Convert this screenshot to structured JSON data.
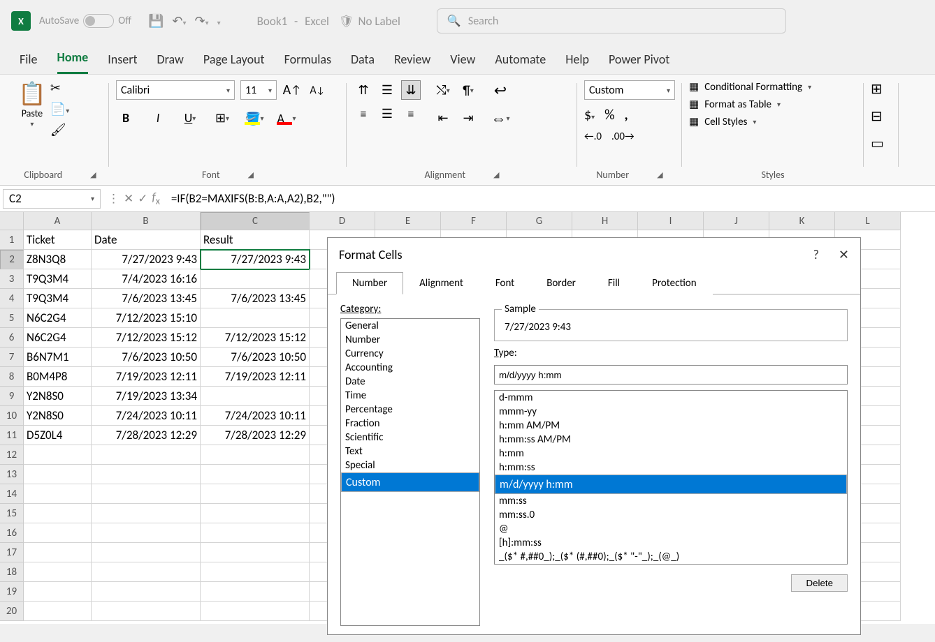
{
  "titlebar": {
    "autosave_label": "AutoSave",
    "autosave_state": "Off",
    "doc_name": "Book1",
    "app_name": "Excel",
    "sensitivity": "No Label",
    "search_placeholder": "Search"
  },
  "menu": [
    "File",
    "Home",
    "Insert",
    "Draw",
    "Page Layout",
    "Formulas",
    "Data",
    "Review",
    "View",
    "Automate",
    "Help",
    "Power Pivot"
  ],
  "menu_active": "Home",
  "ribbon": {
    "clipboard_label": "Clipboard",
    "paste": "Paste",
    "font_label": "Font",
    "font_name": "Calibri",
    "font_size": "11",
    "align_label": "Alignment",
    "number_label": "Number",
    "number_format": "Custom",
    "styles_label": "Styles",
    "cond_fmt": "Conditional Formatting",
    "as_table": "Format as Table",
    "cell_styles": "Cell Styles"
  },
  "name_box": "C2",
  "formula": "=IF(B2=MAXIFS(B:B,A:A,A2),B2,\"\")",
  "columns": [
    "A",
    "B",
    "C",
    "D",
    "E",
    "F",
    "G",
    "H",
    "I",
    "J",
    "K",
    "L"
  ],
  "rows": [
    "1",
    "2",
    "3",
    "4",
    "5",
    "6",
    "7",
    "8",
    "9",
    "10",
    "11",
    "12",
    "13",
    "14",
    "15",
    "16",
    "17",
    "18",
    "19",
    "20"
  ],
  "active_row": "2",
  "active_col": "C",
  "sheet": {
    "header": [
      "Ticket",
      "Date",
      "Result"
    ],
    "data": [
      [
        "Z8N3Q8",
        "7/27/2023 9:43",
        "7/27/2023 9:43"
      ],
      [
        "T9Q3M4",
        "7/4/2023 16:16",
        ""
      ],
      [
        "T9Q3M4",
        "7/6/2023 13:45",
        "7/6/2023 13:45"
      ],
      [
        "N6C2G4",
        "7/12/2023 15:10",
        ""
      ],
      [
        "N6C2G4",
        "7/12/2023 15:12",
        "7/12/2023 15:12"
      ],
      [
        "B6N7M1",
        "7/6/2023 10:50",
        "7/6/2023 10:50"
      ],
      [
        "B0M4P8",
        "7/19/2023 12:11",
        "7/19/2023 12:11"
      ],
      [
        "Y2N8S0",
        "7/19/2023 13:34",
        ""
      ],
      [
        "Y2N8S0",
        "7/24/2023 10:11",
        "7/24/2023 10:11"
      ],
      [
        "D5Z0L4",
        "7/28/2023 12:29",
        "7/28/2023 12:29"
      ]
    ]
  },
  "dialog": {
    "title": "Format Cells",
    "tabs": [
      "Number",
      "Alignment",
      "Font",
      "Border",
      "Fill",
      "Protection"
    ],
    "tab_active": "Number",
    "category_label": "Category:",
    "categories": [
      "General",
      "Number",
      "Currency",
      "Accounting",
      "Date",
      "Time",
      "Percentage",
      "Fraction",
      "Scientific",
      "Text",
      "Special",
      "Custom"
    ],
    "category_selected": "Custom",
    "sample_label": "Sample",
    "sample_value": "7/27/2023 9:43",
    "type_label": "Type:",
    "type_value": "m/d/yyyy h:mm",
    "type_list": [
      "d-mmm",
      "mmm-yy",
      "h:mm AM/PM",
      "h:mm:ss AM/PM",
      "h:mm",
      "h:mm:ss",
      "m/d/yyyy h:mm",
      "mm:ss",
      "mm:ss.0",
      "@",
      "[h]:mm:ss",
      "_($* #,##0_);_($* (#,##0);_($* \"-\"_);_(@_)"
    ],
    "type_selected": "m/d/yyyy h:mm",
    "delete": "Delete"
  }
}
